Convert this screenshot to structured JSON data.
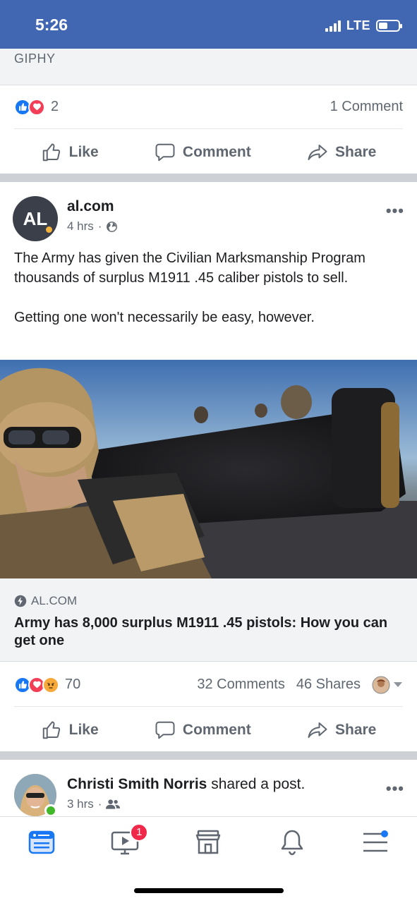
{
  "status_bar": {
    "time": "5:26",
    "network": "LTE",
    "battery_level": 0.45
  },
  "prev_post": {
    "attribution": "GIPHY",
    "reaction_count": "2",
    "comments": "1 Comment"
  },
  "actions": {
    "like": "Like",
    "comment": "Comment",
    "share": "Share"
  },
  "post": {
    "page_name": "al.com",
    "avatar_text": "AL",
    "time": "4 hrs",
    "separator": "·",
    "paragraph1": "The Army has given the Civilian Marksmanship Program thousands of surplus M1911 .45 caliber pistols to sell.",
    "paragraph2": "Getting one won't necessarily be easy, however.",
    "link_domain": "AL.COM",
    "link_headline": "Army has 8,000 surplus M1911 .45 pistols: How you can get one",
    "reaction_count": "70",
    "comments": "32 Comments",
    "shares": "46 Shares"
  },
  "next_post": {
    "author": "Christi Smith Norris",
    "action_text": " shared a post.",
    "time": "3 hrs",
    "separator": "·"
  },
  "tab_bar": {
    "video_badge": "1",
    "tabs": [
      "news-feed",
      "watch",
      "marketplace",
      "notifications",
      "menu"
    ]
  },
  "colors": {
    "brand": "#4267b2",
    "like": "#1877f2",
    "love": "#f33e58",
    "online": "#42b72a",
    "badge": "#f02849"
  }
}
